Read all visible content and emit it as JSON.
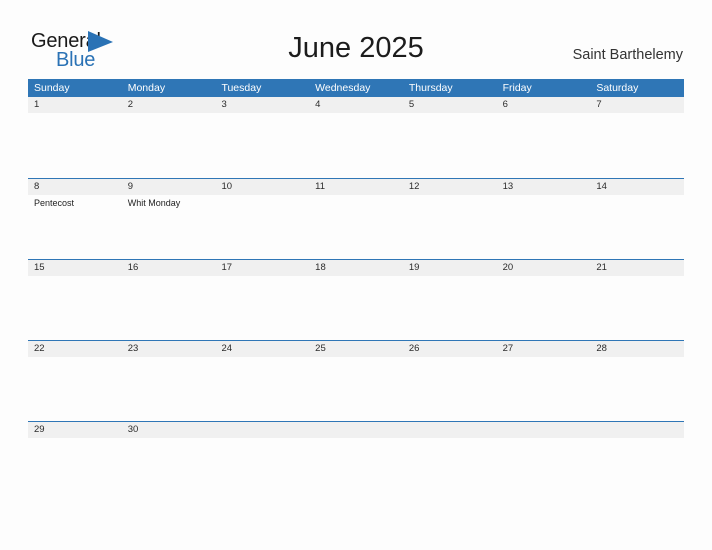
{
  "brand": {
    "name_part1": "General",
    "name_part2": "Blue",
    "flag_icon": "blue-triangle-flag-icon",
    "color_primary": "#2a72b5",
    "color_text": "#1a1a1a"
  },
  "header": {
    "title": "June 2025",
    "locale": "Saint Barthelemy"
  },
  "colors": {
    "header_blue": "#2f76b6",
    "date_band_gray": "#f0f0f0",
    "page_background": "#fdfdfd",
    "text_dark": "#2b2b2b"
  },
  "weekdays": [
    {
      "label": "Sunday"
    },
    {
      "label": "Monday"
    },
    {
      "label": "Tuesday"
    },
    {
      "label": "Wednesday"
    },
    {
      "label": "Thursday"
    },
    {
      "label": "Friday"
    },
    {
      "label": "Saturday"
    }
  ],
  "weeks": [
    {
      "days": [
        {
          "date": "1",
          "events": []
        },
        {
          "date": "2",
          "events": []
        },
        {
          "date": "3",
          "events": []
        },
        {
          "date": "4",
          "events": []
        },
        {
          "date": "5",
          "events": []
        },
        {
          "date": "6",
          "events": []
        },
        {
          "date": "7",
          "events": []
        }
      ]
    },
    {
      "days": [
        {
          "date": "8",
          "events": [
            {
              "name": "Pentecost"
            }
          ]
        },
        {
          "date": "9",
          "events": [
            {
              "name": "Whit Monday"
            }
          ]
        },
        {
          "date": "10",
          "events": []
        },
        {
          "date": "11",
          "events": []
        },
        {
          "date": "12",
          "events": []
        },
        {
          "date": "13",
          "events": []
        },
        {
          "date": "14",
          "events": []
        }
      ]
    },
    {
      "days": [
        {
          "date": "15",
          "events": []
        },
        {
          "date": "16",
          "events": []
        },
        {
          "date": "17",
          "events": []
        },
        {
          "date": "18",
          "events": []
        },
        {
          "date": "19",
          "events": []
        },
        {
          "date": "20",
          "events": []
        },
        {
          "date": "21",
          "events": []
        }
      ]
    },
    {
      "days": [
        {
          "date": "22",
          "events": []
        },
        {
          "date": "23",
          "events": []
        },
        {
          "date": "24",
          "events": []
        },
        {
          "date": "25",
          "events": []
        },
        {
          "date": "26",
          "events": []
        },
        {
          "date": "27",
          "events": []
        },
        {
          "date": "28",
          "events": []
        }
      ]
    },
    {
      "days": [
        {
          "date": "29",
          "events": []
        },
        {
          "date": "30",
          "events": []
        },
        {
          "date": "",
          "events": []
        },
        {
          "date": "",
          "events": []
        },
        {
          "date": "",
          "events": []
        },
        {
          "date": "",
          "events": []
        },
        {
          "date": "",
          "events": []
        }
      ]
    }
  ]
}
